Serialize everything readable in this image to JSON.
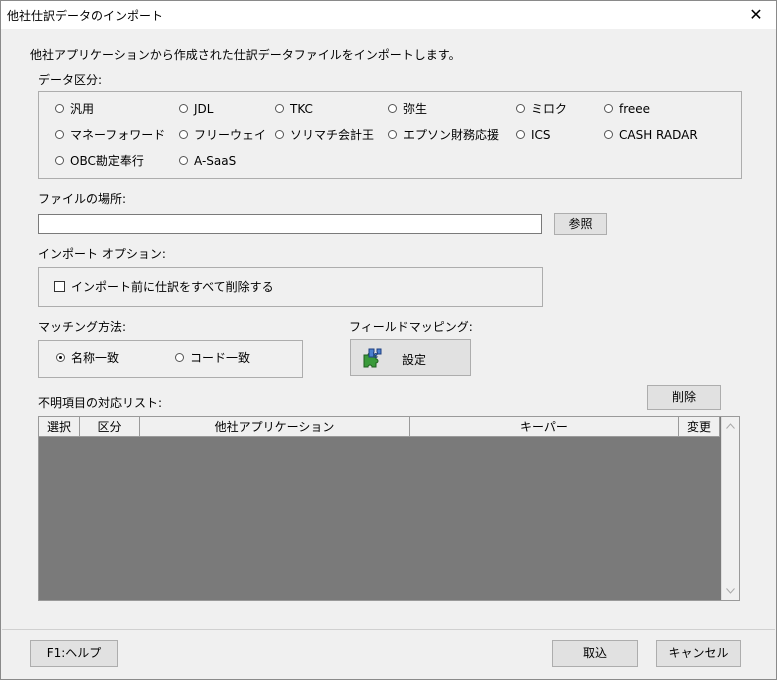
{
  "window": {
    "title": "他社仕訳データのインポート",
    "close_glyph": "✕"
  },
  "intro": "他社アプリケーションから作成された仕訳データファイルをインポートします。",
  "data_category": {
    "label": "データ区分:",
    "options": [
      "汎用",
      "JDL",
      "TKC",
      "弥生",
      "ミロク",
      "freee",
      "マネーフォワード",
      "フリーウェイ",
      "ソリマチ会計王",
      "エプソン財務応援",
      "ICS",
      "CASH RADAR",
      "OBC勘定奉行",
      "A-SaaS"
    ],
    "selected": null
  },
  "file_location": {
    "label": "ファイルの場所:",
    "value": "",
    "browse_label": "参照"
  },
  "import_options": {
    "label": "インポート オプション:",
    "delete_before_label": "インポート前に仕訳をすべて削除する",
    "delete_before_checked": false
  },
  "matching": {
    "label": "マッチング方法:",
    "options": [
      "名称一致",
      "コード一致"
    ],
    "selected": "名称一致"
  },
  "field_mapping": {
    "label": "フィールドマッピング:",
    "button_label": "設定",
    "icon": "puzzle-icon"
  },
  "unknown_list": {
    "label": "不明項目の対応リスト:",
    "delete_label": "削除",
    "columns": [
      "選択",
      "区分",
      "他社アプリケーション",
      "キーパー",
      "変更"
    ],
    "rows": []
  },
  "footer": {
    "help_label": "F1:ヘルプ",
    "import_label": "取込",
    "cancel_label": "キャンセル"
  }
}
